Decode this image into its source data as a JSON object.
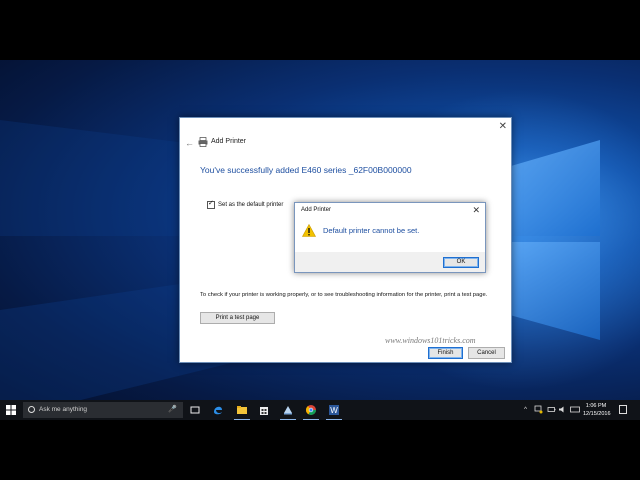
{
  "main_dialog": {
    "title": "Add Printer",
    "close_glyph": "✕",
    "back_glyph": "←",
    "heading": "You've successfully added E460 series _62F00B000000",
    "checkbox_label": "Set as the default printer",
    "checkbox_checked": true,
    "info_text": "To check if your printer is working properly, or to see troubleshooting information for the printer, print a test page.",
    "test_button": "Print a test page",
    "finish_button": "Finish",
    "cancel_button": "Cancel"
  },
  "popup": {
    "title": "Add Printer",
    "close_glyph": "✕",
    "message": "Default printer cannot be set.",
    "ok_button": "OK",
    "icon": "warning-icon"
  },
  "watermark": "www.windows101tricks.com",
  "taskbar": {
    "search_placeholder": "Ask me anything",
    "mic_glyph": "🎤",
    "apps": [
      "task-view",
      "edge",
      "file-explorer",
      "store",
      "app-5",
      "chrome",
      "word"
    ],
    "tray_chevron": "^",
    "clock_time": "1:06 PM",
    "clock_date": "12/15/2016"
  },
  "colors": {
    "accent": "#1e4fa0",
    "wallpaper_dark": "#061a45",
    "wallpaper_light": "#2f7fd6",
    "taskbar": "#101318"
  }
}
